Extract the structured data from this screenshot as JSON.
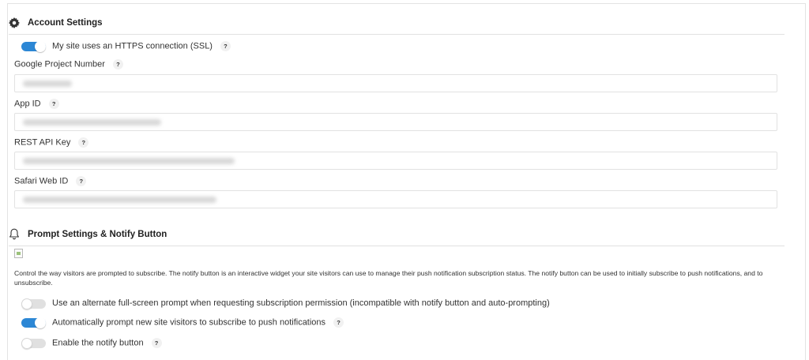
{
  "account": {
    "title": "Account Settings",
    "icon": "gear-icon",
    "https_toggle": {
      "label": "My site uses an HTTPS connection (SSL)",
      "on": true,
      "help": "?"
    },
    "fields": [
      {
        "label": "Google Project Number",
        "help": "?",
        "value_redacted": true
      },
      {
        "label": "App ID",
        "help": "?",
        "value_redacted": true
      },
      {
        "label": "REST API Key",
        "help": "?",
        "value_redacted": true
      },
      {
        "label": "Safari Web ID",
        "help": "?",
        "value_redacted": true
      }
    ]
  },
  "prompt": {
    "title": "Prompt Settings & Notify Button",
    "icon": "bell-icon",
    "description": "Control the way visitors are prompted to subscribe. The notify button is an interactive widget your site visitors can use to manage their push notification subscription status. The notify button can be used to initially subscribe to push notifications, and to unsubscribe.",
    "toggles": [
      {
        "label": "Use an alternate full-screen prompt when requesting subscription permission (incompatible with notify button and auto-prompting)",
        "on": false,
        "help": ""
      },
      {
        "label": "Automatically prompt new site visitors to subscribe to push notifications",
        "on": true,
        "help": "?"
      },
      {
        "label": "Enable the notify button",
        "on": false,
        "help": "?"
      }
    ]
  },
  "colors": {
    "accent": "#2c87d5",
    "toggle_off": "#e0e0e0",
    "border": "#e2e2e2"
  }
}
